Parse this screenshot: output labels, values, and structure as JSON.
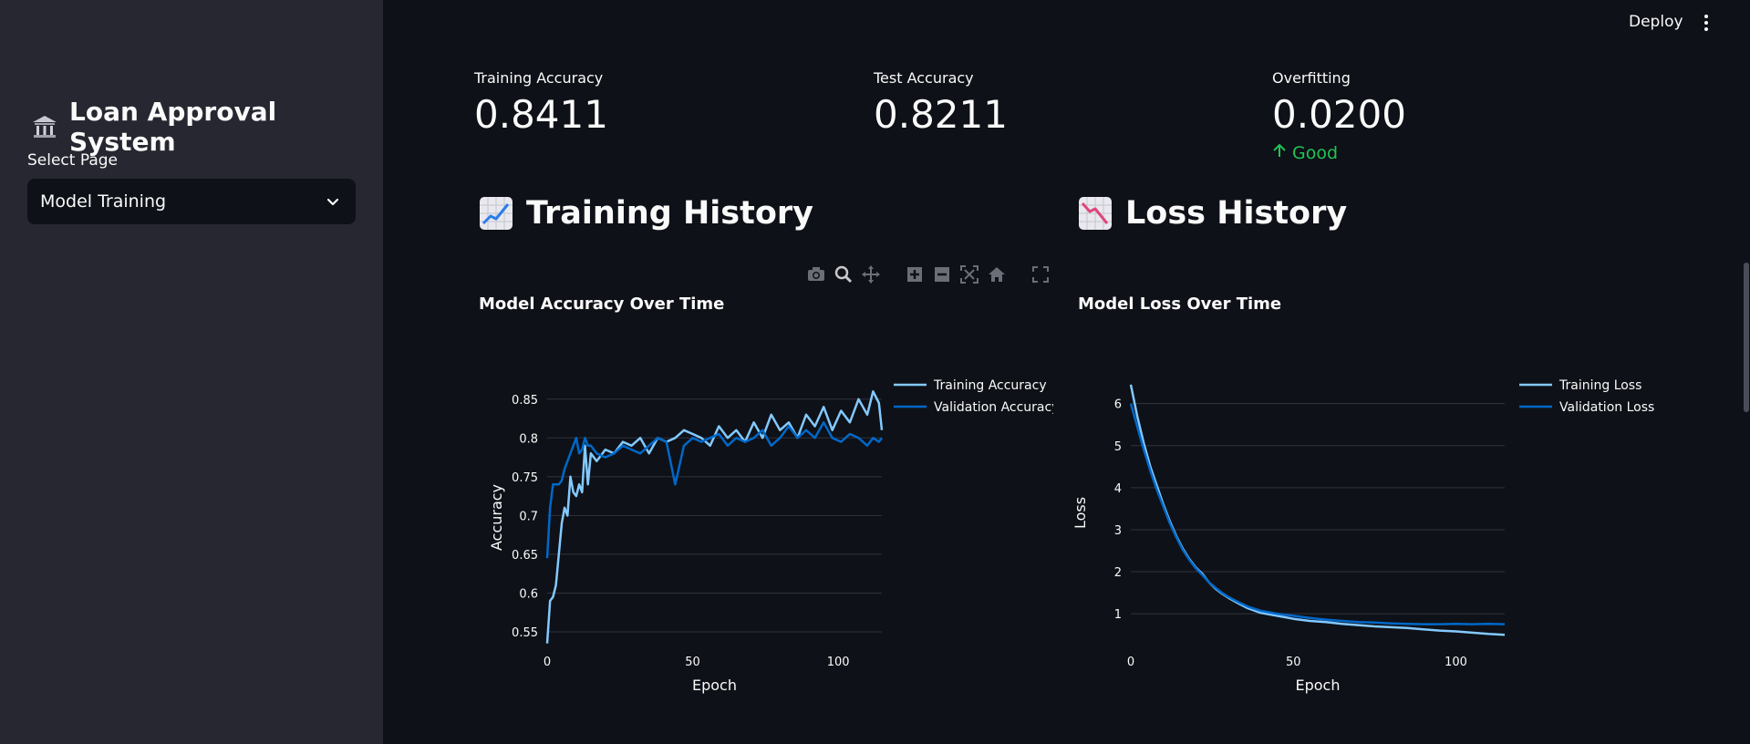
{
  "header": {
    "deploy_label": "Deploy",
    "menu_icon": "kebab-menu-icon"
  },
  "sidebar": {
    "title": "Loan Approval System",
    "title_icon": "bank-icon",
    "select_label": "Select Page",
    "select_value": "Model Training"
  },
  "metrics": [
    {
      "label": "Training Accuracy",
      "value": "0.8411"
    },
    {
      "label": "Test Accuracy",
      "value": "0.8211"
    },
    {
      "label": "Overfitting",
      "value": "0.0200",
      "delta": "Good",
      "delta_color": "#21c354"
    }
  ],
  "sections": {
    "training": {
      "title": "Training History",
      "icon": "chart-increasing-icon"
    },
    "loss": {
      "title": "Loss History",
      "icon": "chart-decreasing-icon"
    }
  },
  "modebar": [
    "camera-icon",
    "zoom-icon",
    "pan-icon",
    "zoom-in-icon",
    "zoom-out-icon",
    "autoscale-icon",
    "reset-home-icon",
    "fullscreen-icon"
  ],
  "chart_data": [
    {
      "type": "line",
      "title": "Model Accuracy Over Time",
      "xlabel": "Epoch",
      "ylabel": "Accuracy",
      "xlim": [
        0,
        115
      ],
      "ylim": [
        0.53,
        0.865
      ],
      "x_ticks": [
        0,
        50,
        100
      ],
      "y_ticks": [
        0.55,
        0.6,
        0.65,
        0.7,
        0.75,
        0.8,
        0.85
      ],
      "y_tick_labels": [
        "0.55",
        "0.6",
        "0.65",
        "0.7",
        "0.75",
        "0.8",
        "0.85"
      ],
      "grid": true,
      "legend": "top-right",
      "series": [
        {
          "name": "Training Accuracy",
          "color": "#83c9ff",
          "x": [
            0,
            1,
            2,
            3,
            4,
            5,
            6,
            7,
            8,
            9,
            10,
            11,
            12,
            13,
            14,
            15,
            17,
            20,
            23,
            26,
            29,
            32,
            35,
            38,
            41,
            44,
            47,
            50,
            53,
            56,
            59,
            62,
            65,
            68,
            71,
            74,
            77,
            80,
            83,
            86,
            89,
            92,
            95,
            98,
            101,
            104,
            107,
            110,
            112,
            114,
            115
          ],
          "y": [
            0.535,
            0.59,
            0.595,
            0.61,
            0.65,
            0.69,
            0.71,
            0.7,
            0.75,
            0.73,
            0.725,
            0.74,
            0.73,
            0.79,
            0.74,
            0.78,
            0.77,
            0.785,
            0.78,
            0.795,
            0.79,
            0.8,
            0.78,
            0.8,
            0.795,
            0.8,
            0.81,
            0.805,
            0.8,
            0.79,
            0.815,
            0.8,
            0.81,
            0.795,
            0.82,
            0.8,
            0.83,
            0.81,
            0.82,
            0.8,
            0.83,
            0.815,
            0.84,
            0.81,
            0.835,
            0.82,
            0.85,
            0.83,
            0.86,
            0.845,
            0.81
          ]
        },
        {
          "name": "Validation Accuracy",
          "color": "#0068c9",
          "x": [
            0,
            1,
            2,
            3,
            4,
            5,
            6,
            7,
            8,
            9,
            10,
            11,
            12,
            13,
            14,
            15,
            17,
            20,
            23,
            26,
            29,
            32,
            35,
            38,
            41,
            44,
            47,
            50,
            53,
            56,
            59,
            62,
            65,
            68,
            71,
            74,
            77,
            80,
            83,
            86,
            89,
            92,
            95,
            98,
            101,
            104,
            107,
            110,
            112,
            114,
            115
          ],
          "y": [
            0.645,
            0.71,
            0.74,
            0.74,
            0.74,
            0.745,
            0.76,
            0.77,
            0.78,
            0.79,
            0.8,
            0.78,
            0.785,
            0.8,
            0.79,
            0.79,
            0.78,
            0.775,
            0.78,
            0.79,
            0.785,
            0.78,
            0.79,
            0.8,
            0.795,
            0.74,
            0.79,
            0.8,
            0.795,
            0.8,
            0.805,
            0.79,
            0.8,
            0.795,
            0.8,
            0.81,
            0.79,
            0.8,
            0.815,
            0.8,
            0.81,
            0.8,
            0.82,
            0.8,
            0.795,
            0.805,
            0.8,
            0.79,
            0.8,
            0.795,
            0.8
          ]
        }
      ]
    },
    {
      "type": "line",
      "title": "Model Loss Over Time",
      "xlabel": "Epoch",
      "ylabel": "Loss",
      "xlim": [
        0,
        115
      ],
      "ylim": [
        0.2,
        6.6
      ],
      "x_ticks": [
        0,
        50,
        100
      ],
      "y_ticks": [
        1,
        2,
        3,
        4,
        5,
        6
      ],
      "y_tick_labels": [
        "1",
        "2",
        "3",
        "4",
        "5",
        "6"
      ],
      "grid": true,
      "legend": "top-right",
      "series": [
        {
          "name": "Training Loss",
          "color": "#83c9ff",
          "x": [
            0,
            2,
            4,
            6,
            8,
            10,
            12,
            14,
            16,
            18,
            20,
            22,
            24,
            26,
            28,
            30,
            33,
            36,
            40,
            45,
            50,
            55,
            60,
            65,
            70,
            75,
            80,
            85,
            90,
            95,
            100,
            105,
            110,
            115
          ],
          "y": [
            6.45,
            5.7,
            5.05,
            4.5,
            4.05,
            3.6,
            3.2,
            2.85,
            2.55,
            2.3,
            2.1,
            1.95,
            1.75,
            1.6,
            1.48,
            1.38,
            1.25,
            1.13,
            1.02,
            0.95,
            0.88,
            0.83,
            0.8,
            0.76,
            0.73,
            0.7,
            0.68,
            0.66,
            0.63,
            0.6,
            0.58,
            0.55,
            0.52,
            0.5
          ]
        },
        {
          "name": "Validation Loss",
          "color": "#0068c9",
          "x": [
            0,
            2,
            4,
            6,
            8,
            10,
            12,
            14,
            16,
            18,
            20,
            22,
            24,
            26,
            28,
            30,
            33,
            36,
            40,
            45,
            50,
            55,
            60,
            65,
            70,
            75,
            80,
            85,
            90,
            95,
            100,
            105,
            110,
            115
          ],
          "y": [
            6.0,
            5.45,
            4.9,
            4.4,
            3.95,
            3.55,
            3.15,
            2.82,
            2.52,
            2.28,
            2.08,
            1.92,
            1.75,
            1.62,
            1.5,
            1.4,
            1.28,
            1.17,
            1.07,
            1.0,
            0.95,
            0.9,
            0.86,
            0.83,
            0.8,
            0.79,
            0.77,
            0.76,
            0.75,
            0.75,
            0.76,
            0.75,
            0.76,
            0.75
          ]
        }
      ]
    }
  ]
}
